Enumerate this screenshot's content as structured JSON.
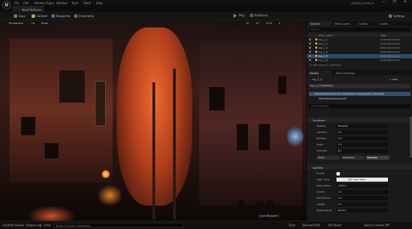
{
  "app": {
    "logo_text": "U",
    "project_name": "project_name_a",
    "level_tab": "NewCityScene",
    "menu": [
      "File",
      "Edit",
      "Window Pages",
      "Window",
      "Tools",
      "Build",
      "Help"
    ],
    "window_controls": [
      "—",
      "❐",
      "✕"
    ]
  },
  "toolbar": {
    "buttons": [
      "Save",
      "Content",
      "Blueprints",
      "Cinematics"
    ],
    "play_label": "Play",
    "platforms_label": "Platforms",
    "settings_label": "Settings"
  },
  "viewport": {
    "perspective_label": "Perspective",
    "lit_label": "Lit",
    "show_label": "Show",
    "grid_snap": "10",
    "rotation_snap": "10°",
    "scale_snap": "0.25",
    "camera_speed": "4",
    "bottom_label": "Level Blueprint"
  },
  "outliner": {
    "tab_label": "Outliner",
    "tabs": [
      "Outliner",
      "Data Layers",
      "Layers",
      "Levels"
    ],
    "search_placeholder": "Search...",
    "col_label": "Item Label",
    "col_type": "Type",
    "rows": [
      {
        "label": "ivy_1_1",
        "type": "StaticMeshActor"
      },
      {
        "label": "ivy_1_2",
        "type": "StaticMeshActor"
      },
      {
        "label": "ivy_1_3",
        "type": "StaticMeshActor"
      },
      {
        "label": "ivy_1_4",
        "type": "StaticMeshActor"
      },
      {
        "label": "ivy_1_5",
        "type": "StaticMeshActor"
      },
      {
        "label": "ivy_1_6",
        "type": "StaticMeshActor"
      }
    ],
    "footer": "13,406 actors (1 selected)"
  },
  "details": {
    "tabs": [
      "Details",
      "World Settings"
    ],
    "add_label": "+ Add",
    "actor_name": "ivy_1_5",
    "root_component": "ivy_1_5 (Instance)",
    "components": [
      "StaticMeshComponent (StaticMeshComponent0) (Inherited)",
      "StaticMeshComponent0"
    ],
    "search_placeholder": "Search Details",
    "sections": {
      "transform": "Transform",
      "lighting": "Lighting"
    },
    "props": [
      {
        "label": "Mobility",
        "value": "Movable"
      },
      {
        "label": "Location",
        "value": "0.0"
      },
      {
        "label": "Rotation",
        "value": "0.0"
      },
      {
        "label": "Scale",
        "value": "1.0"
      },
      {
        "label": "Intensity",
        "value": "8.0"
      }
    ],
    "mobility_options": [
      "Static",
      "Stationary",
      "Movable"
    ],
    "light_props": [
      {
        "label": "Enable",
        "value": ""
      },
      {
        "label": "Light Color",
        "value": ""
      },
      {
        "label": "Attenuation",
        "value": "1000.0"
      },
      {
        "label": "Source",
        "value": "0.0"
      },
      {
        "label": "Soft Radius",
        "value": "0.0"
      },
      {
        "label": "Length",
        "value": "0.0"
      },
      {
        "label": "Temperature",
        "value": "6500.0"
      }
    ],
    "color_label": "Edit Color Value"
  },
  "status": {
    "content_drawer": "Content Drawer",
    "output_log": "Output Log",
    "cmd": "Cmd",
    "console_placeholder": "Enter Console Command",
    "trace": "Trace",
    "derived_data": "Derived Data",
    "revision": "All Saved",
    "source_control": "Source Control Off"
  },
  "colors": {
    "accent_green": "#3fae4b",
    "selection_blue": "#2c4a6e",
    "folder_yellow": "#c9a24a"
  }
}
